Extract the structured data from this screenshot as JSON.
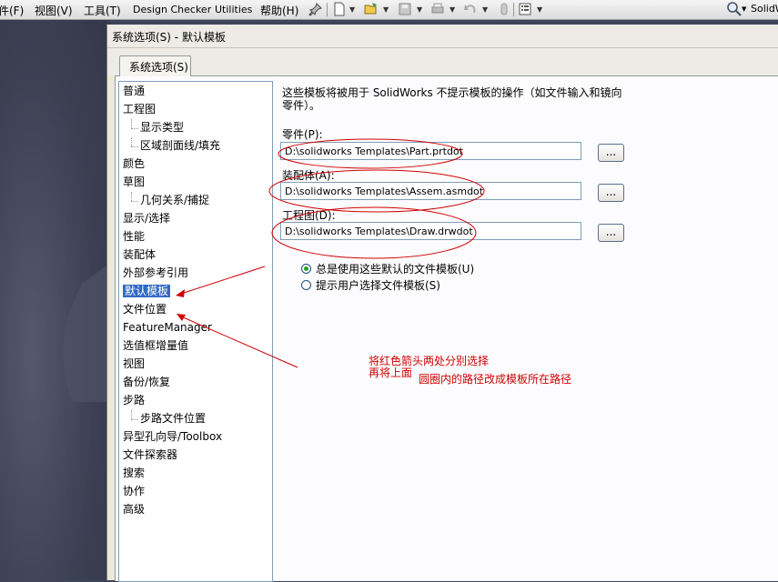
{
  "menubar": {
    "items": [
      "件(F)",
      "视图(V)",
      "工具(T)",
      "Design Checker",
      "Utilities",
      "帮助(H)"
    ],
    "search_text": "SolidW"
  },
  "dialog": {
    "title": "系统选项(S) - 默认模板",
    "tab": "系统选项(S)",
    "tree": [
      {
        "label": "普通",
        "level": 0
      },
      {
        "label": "工程图",
        "level": 0
      },
      {
        "label": "显示类型",
        "level": 1
      },
      {
        "label": "区域剖面线/填充",
        "level": 1
      },
      {
        "label": "颜色",
        "level": 0
      },
      {
        "label": "草图",
        "level": 0
      },
      {
        "label": "几何关系/捕捉",
        "level": 1
      },
      {
        "label": "显示/选择",
        "level": 0
      },
      {
        "label": "性能",
        "level": 0
      },
      {
        "label": "装配体",
        "level": 0
      },
      {
        "label": "外部参考引用",
        "level": 0
      },
      {
        "label": "默认模板",
        "level": 0
      },
      {
        "label": "文件位置",
        "level": 0
      },
      {
        "label": "FeatureManager",
        "level": 0
      },
      {
        "label": "选值框增量值",
        "level": 0
      },
      {
        "label": "视图",
        "level": 0
      },
      {
        "label": "备份/恢复",
        "level": 0
      },
      {
        "label": "步路",
        "level": 0
      },
      {
        "label": "步路文件位置",
        "level": 1
      },
      {
        "label": "异型孔向导/Toolbox",
        "level": 0
      },
      {
        "label": "文件探索器",
        "level": 0
      },
      {
        "label": "搜索",
        "level": 0
      },
      {
        "label": "协作",
        "level": 0
      },
      {
        "label": "高级",
        "level": 0
      }
    ],
    "selected_index": 11,
    "description": "这些模板将被用于 SolidWorks 不提示模板的操作（如文件输入和镜向零件）。",
    "part_label": "零件(P):",
    "part_path": "D:\\solidworks Templates\\Part.prtdot",
    "assembly_label": "装配体(A):",
    "assembly_path": "D:\\solidworks Templates\\Assem.asmdot",
    "drawing_label": "工程图(D):",
    "drawing_path": "D:\\solidworks Templates\\Draw.drwdot",
    "browse_label": "...",
    "radio_always": "总是使用这些默认的文件模板(U)",
    "radio_prompt": "提示用户选择文件模板(S)",
    "radio_selected": "always"
  },
  "annotation": {
    "line1": "将红色箭头两处分别选择",
    "line2": "再将上面",
    "line3": "圆圈内的路径改成模板所在路径",
    "color": "#d00000"
  }
}
